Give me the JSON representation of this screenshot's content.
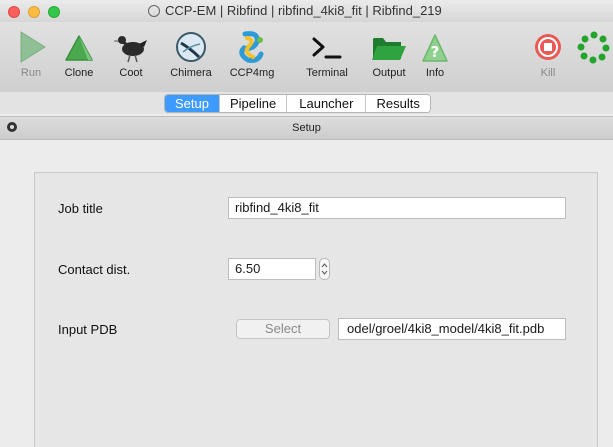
{
  "window": {
    "title": "CCP-EM | Ribfind | ribfind_4ki8_fit | Ribfind_219"
  },
  "toolbar": {
    "run_label": "Run",
    "clone_label": "Clone",
    "coot_label": "Coot",
    "chimera_label": "Chimera",
    "ccp4mg_label": "CCP4mg",
    "terminal_label": "Terminal",
    "output_label": "Output",
    "info_label": "Info",
    "kill_label": "Kill"
  },
  "tabs": [
    "Setup",
    "Pipeline",
    "Launcher",
    "Results"
  ],
  "active_tab": "Setup",
  "panel": {
    "title": "Setup"
  },
  "form": {
    "job_title_label": "Job title",
    "job_title_value": "ribfind_4ki8_fit",
    "contact_dist_label": "Contact dist.",
    "contact_dist_value": "6.50",
    "input_pdb_label": "Input PDB",
    "select_label": "Select",
    "input_pdb_value": "odel/groel/4ki8_model/4ki8_fit.pdb"
  },
  "colors": {
    "active_tab": "#3d9aff",
    "run_green": "#3f9d4b",
    "kill_red": "#e0413a",
    "busy_green": "#22a52a"
  }
}
